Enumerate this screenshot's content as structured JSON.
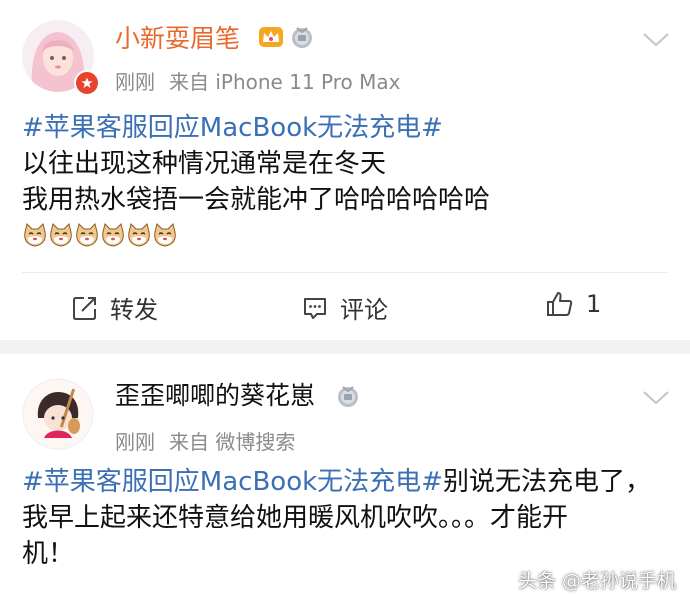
{
  "posts": [
    {
      "author": "小新耍眉笔",
      "time": "刚刚",
      "source": "来自 iPhone 11 Pro Max",
      "hashtag": "#苹果客服回应MacBook无法充电#",
      "lines": [
        "以往出现这种情况通常是在冬天",
        "我用热水袋捂一会就能冲了哈哈哈哈哈哈"
      ],
      "emoji_count": 6,
      "actions": {
        "repost": "转发",
        "comment": "评论",
        "like_count": "1"
      }
    },
    {
      "author": "歪歪唧唧的葵花崽",
      "time": "刚刚",
      "source": "来自 微博搜索",
      "hashtag": "#苹果客服回应MacBook无法充电#",
      "line1_rest": "别说无法充电了，",
      "lines": [
        "我早上起来还特意给她用暖风机吹吹。。。才能开",
        "机！"
      ]
    }
  ],
  "watermark": "头条 @老孙说手机",
  "colors": {
    "author_orange": "#e9692c",
    "hashtag_blue": "#3b6fb6",
    "meta_gray": "#8a8a8a"
  }
}
